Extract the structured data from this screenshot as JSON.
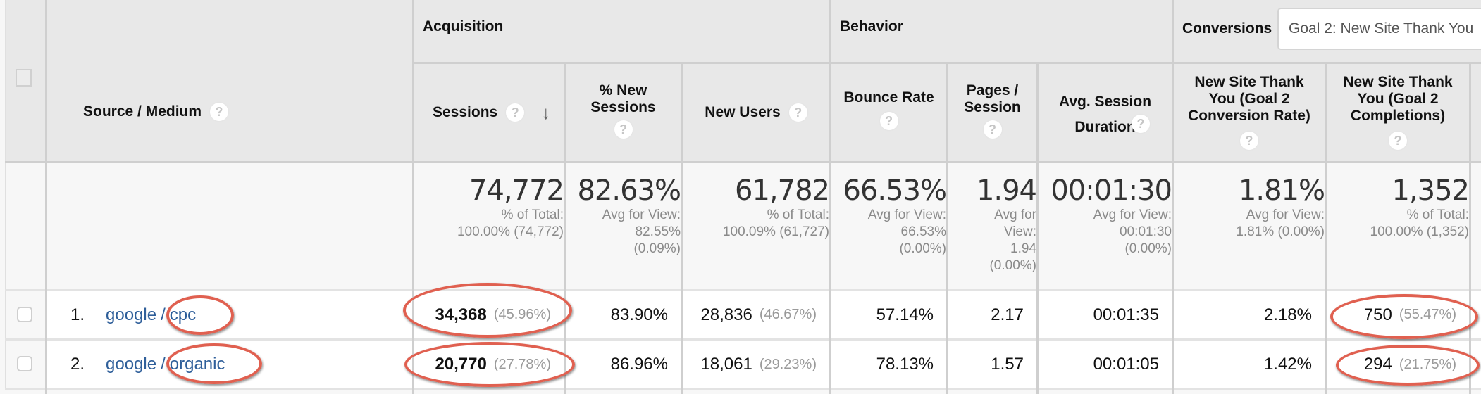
{
  "table": {
    "groups": {
      "acquisition": "Acquisition",
      "behavior": "Behavior",
      "conversions": "Conversions"
    },
    "goal_selector": {
      "selected": "Goal 2: New Site Thank You"
    },
    "help_glyph": "?",
    "sort_icon": "↓",
    "columns": {
      "source_medium": "Source / Medium",
      "sessions": "Sessions",
      "pct_new_sessions": "% New Sessions",
      "new_users": "New Users",
      "bounce_rate": "Bounce Rate",
      "pages_session": "Pages / Session",
      "avg_session_duration": "Avg. Session Duration",
      "goal_conv_rate": "New Site Thank You (Goal 2 Conversion Rate)",
      "goal_completions": "New Site Thank You (Goal 2 Completions)"
    },
    "totals": {
      "sessions": {
        "value": "74,772",
        "line1": "% of Total:",
        "line2": "100.00% (74,772)"
      },
      "pct_new_sessions": {
        "value": "82.63%",
        "line1": "Avg for View:",
        "line2": "82.55%",
        "line3": "(0.09%)"
      },
      "new_users": {
        "value": "61,782",
        "line1": "% of Total:",
        "line2": "100.09% (61,727)"
      },
      "bounce_rate": {
        "value": "66.53%",
        "line1": "Avg for View:",
        "line2": "66.53%",
        "line3": "(0.00%)"
      },
      "pages_session": {
        "value": "1.94",
        "line1": "Avg for",
        "line2": "View:",
        "line3": "1.94",
        "line4": "(0.00%)"
      },
      "avg_session_duration": {
        "value": "00:01:30",
        "line1": "Avg for View:",
        "line2": "00:01:30",
        "line3": "(0.00%)"
      },
      "goal_conv_rate": {
        "value": "1.81%",
        "line1": "Avg for View:",
        "line2": "1.81% (0.00%)"
      },
      "goal_completions": {
        "value": "1,352",
        "line1": "% of Total:",
        "line2": "100.00% (1,352)"
      }
    },
    "rows": [
      {
        "index": "1.",
        "source": "google",
        "separator": "/",
        "medium": "cpc",
        "sessions": "34,368",
        "sessions_pct": "(45.96%)",
        "pct_new_sessions": "83.90%",
        "new_users": "28,836",
        "new_users_pct": "(46.67%)",
        "bounce_rate": "57.14%",
        "pages_session": "2.17",
        "avg_session_duration": "00:01:35",
        "goal_conv_rate": "2.18%",
        "goal_completions": "750",
        "goal_completions_pct": "(55.47%)"
      },
      {
        "index": "2.",
        "source": "google",
        "separator": "/",
        "medium": "organic",
        "sessions": "20,770",
        "sessions_pct": "(27.78%)",
        "pct_new_sessions": "86.96%",
        "new_users": "18,061",
        "new_users_pct": "(29.23%)",
        "bounce_rate": "78.13%",
        "pages_session": "1.57",
        "avg_session_duration": "00:01:05",
        "goal_conv_rate": "1.42%",
        "goal_completions": "294",
        "goal_completions_pct": "(21.75%)"
      }
    ]
  },
  "colors": {
    "header_bg": "#e8e8e8",
    "link": "#2f5f9a",
    "annotation": "#e06050"
  }
}
